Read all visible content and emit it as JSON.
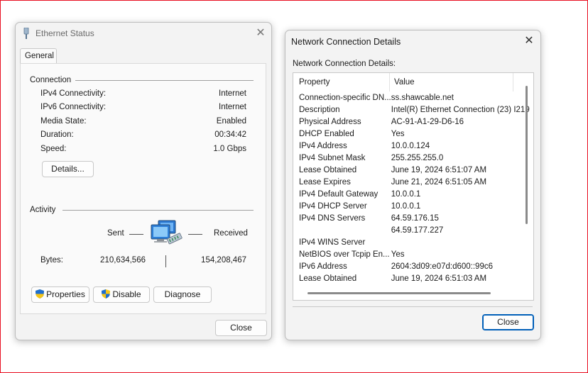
{
  "ethernet_status": {
    "title": "Ethernet Status",
    "tab": "General",
    "connection_header": "Connection",
    "rows": [
      {
        "label": "IPv4 Connectivity:",
        "value": "Internet"
      },
      {
        "label": "IPv6 Connectivity:",
        "value": "Internet"
      },
      {
        "label": "Media State:",
        "value": "Enabled"
      },
      {
        "label": "Duration:",
        "value": "00:34:42"
      },
      {
        "label": "Speed:",
        "value": "1.0 Gbps"
      }
    ],
    "details_button": "Details...",
    "activity_header": "Activity",
    "sent_label": "Sent",
    "received_label": "Received",
    "bytes_label": "Bytes:",
    "bytes_sent": "210,634,566",
    "bytes_received": "154,208,467",
    "properties_button": "Properties",
    "disable_button": "Disable",
    "diagnose_button": "Diagnose",
    "close_button": "Close"
  },
  "details": {
    "title": "Network Connection Details",
    "caption": "Network Connection Details:",
    "col_property": "Property",
    "col_value": "Value",
    "rows": [
      [
        "Connection-specific DN...",
        "ss.shawcable.net"
      ],
      [
        "Description",
        "Intel(R) Ethernet Connection (23) I219"
      ],
      [
        "Physical Address",
        "AC-91-A1-29-D6-16"
      ],
      [
        "DHCP Enabled",
        "Yes"
      ],
      [
        "IPv4 Address",
        "10.0.0.124"
      ],
      [
        "IPv4 Subnet Mask",
        "255.255.255.0"
      ],
      [
        "Lease Obtained",
        "June 19, 2024 6:51:07 AM"
      ],
      [
        "Lease Expires",
        "June 21, 2024 6:51:05 AM"
      ],
      [
        "IPv4 Default Gateway",
        "10.0.0.1"
      ],
      [
        "IPv4 DHCP Server",
        "10.0.0.1"
      ],
      [
        "IPv4 DNS Servers",
        "64.59.176.15"
      ],
      [
        "",
        "64.59.177.227"
      ],
      [
        "IPv4 WINS Server",
        ""
      ],
      [
        "NetBIOS over Tcpip En...",
        "Yes"
      ],
      [
        "IPv6 Address",
        "2604:3d09:e07d:d600::99c6"
      ],
      [
        "Lease Obtained",
        "June 19, 2024 6:51:03 AM"
      ]
    ],
    "close_button": "Close"
  },
  "colors": {
    "accent": "#005fb8",
    "frame": "#e81123"
  },
  "icons": [
    "ethernet-plug-icon",
    "network-computers-icon",
    "shield-icon",
    "close-icon"
  ]
}
